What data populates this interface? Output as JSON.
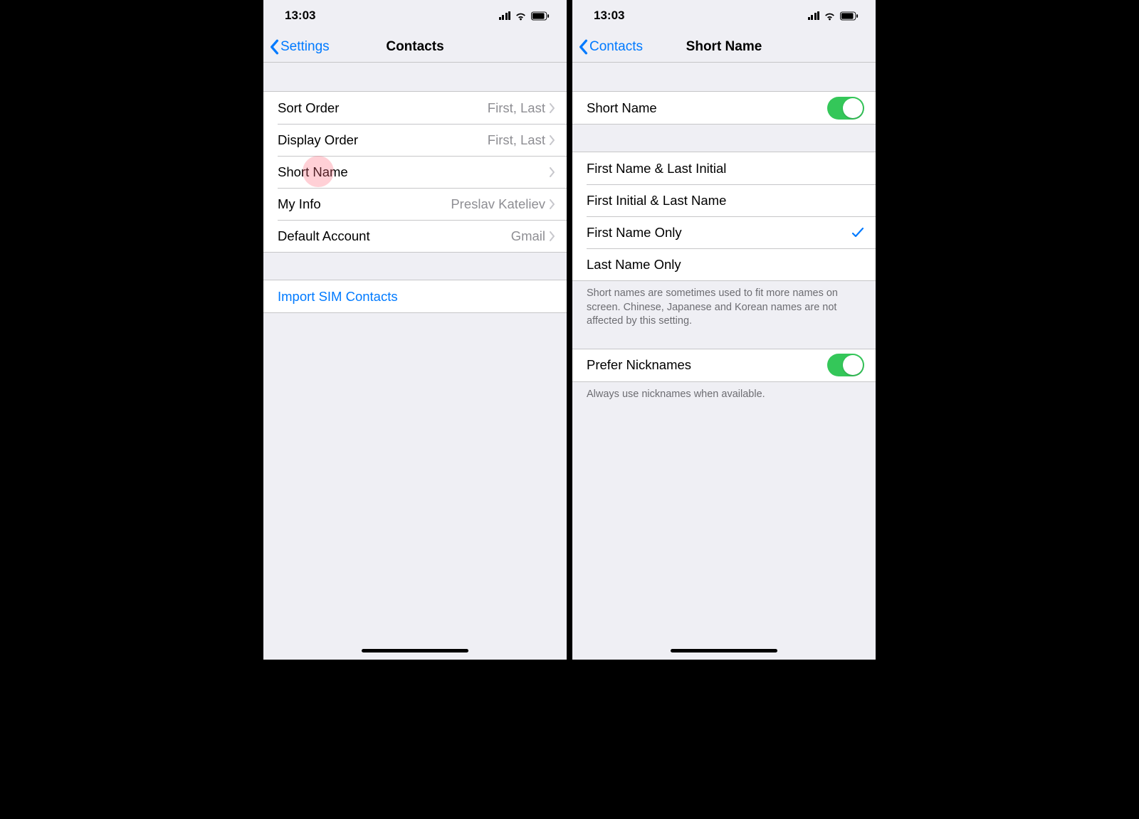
{
  "status": {
    "time": "13:03"
  },
  "left_screen": {
    "nav": {
      "back": "Settings",
      "title": "Contacts"
    },
    "rows": {
      "sort_order": {
        "label": "Sort Order",
        "value": "First, Last"
      },
      "display_order": {
        "label": "Display Order",
        "value": "First, Last"
      },
      "short_name": {
        "label": "Short Name",
        "value": ""
      },
      "my_info": {
        "label": "My Info",
        "value": "Preslav Kateliev"
      },
      "default_account": {
        "label": "Default Account",
        "value": "Gmail"
      }
    },
    "import": {
      "label": "Import SIM Contacts"
    }
  },
  "right_screen": {
    "nav": {
      "back": "Contacts",
      "title": "Short Name"
    },
    "toggle_row": {
      "label": "Short Name",
      "on": true
    },
    "options": [
      {
        "label": "First Name & Last Initial",
        "selected": false
      },
      {
        "label": "First Initial & Last Name",
        "selected": false
      },
      {
        "label": "First Name Only",
        "selected": true
      },
      {
        "label": "Last Name Only",
        "selected": false
      }
    ],
    "options_footer": "Short names are sometimes used to fit more names on screen. Chinese, Japanese and Korean names are not affected by this setting.",
    "nickname_row": {
      "label": "Prefer Nicknames",
      "on": true
    },
    "nickname_footer": "Always use nicknames when available."
  }
}
